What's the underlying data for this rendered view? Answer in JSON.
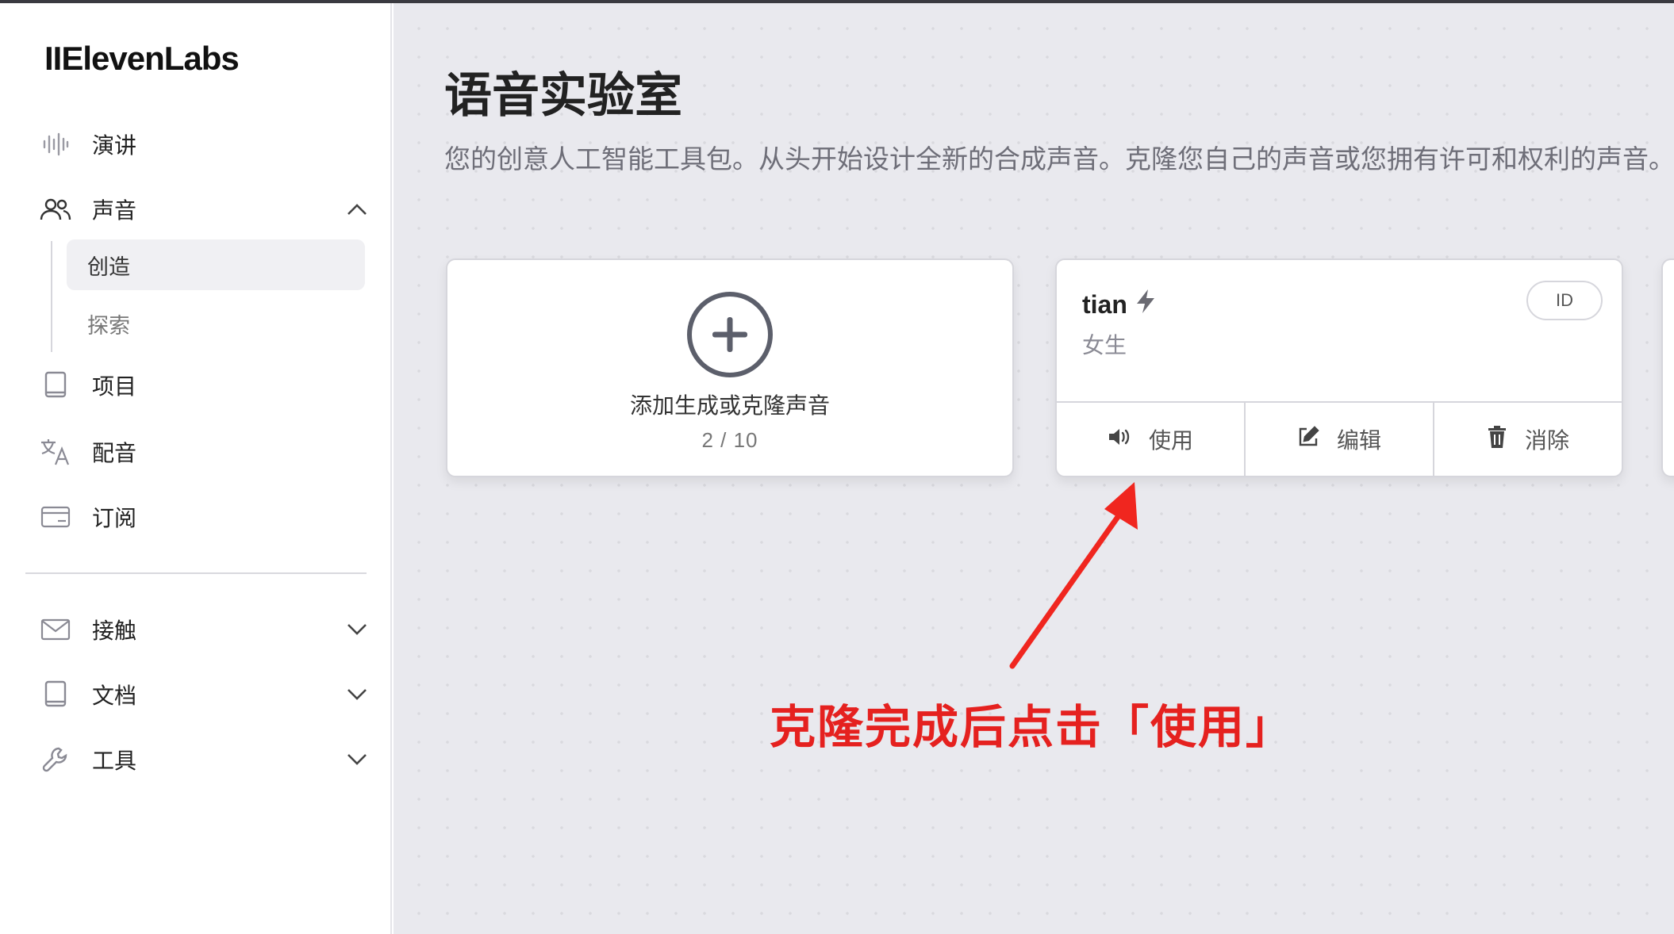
{
  "brand": {
    "logo": "IIElevenLabs"
  },
  "sidebar": {
    "items": [
      {
        "label": "演讲",
        "icon": "waveform-icon"
      },
      {
        "label": "声音",
        "icon": "users-icon"
      },
      {
        "label": "项目",
        "icon": "book-icon"
      },
      {
        "label": "配音",
        "icon": "translate-icon"
      },
      {
        "label": "订阅",
        "icon": "card-icon"
      },
      {
        "label": "接触",
        "icon": "mail-icon"
      },
      {
        "label": "文档",
        "icon": "book-icon"
      },
      {
        "label": "工具",
        "icon": "wrench-icon"
      }
    ],
    "sub_items": [
      {
        "label": "创造",
        "active": true
      },
      {
        "label": "探索",
        "active": false
      }
    ]
  },
  "main": {
    "title": "语音实验室",
    "description": "您的创意人工智能工具包。从头开始设计全新的合成声音。克隆您自己的声音或您拥有许可和权利的声音。",
    "add_card": {
      "label": "添加生成或克隆声音",
      "count": "2 / 10"
    },
    "voice_card": {
      "name": "tian",
      "tag": "女生",
      "id_label": "ID",
      "actions": [
        {
          "label": "使用",
          "icon": "speaker-icon"
        },
        {
          "label": "编辑",
          "icon": "edit-icon"
        },
        {
          "label": "消除",
          "icon": "trash-icon"
        }
      ]
    }
  },
  "annotation": {
    "text": "克隆完成后点击「使用」",
    "color": "#e5211f"
  }
}
